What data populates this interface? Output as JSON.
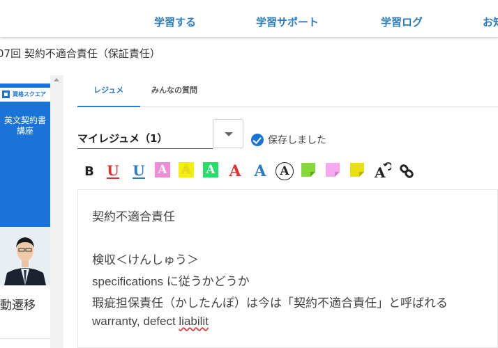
{
  "nav": {
    "items": [
      "学習する",
      "学習サポート",
      "学習ログ",
      "お知"
    ]
  },
  "breadcrumb": "07回 契約不適合責任（保証責任）",
  "left": {
    "logo_text": "資格スクエア",
    "course_title": "英文契約書\n講座",
    "label": "動遷移"
  },
  "tabs": [
    "レジュメ",
    "みんなの質問"
  ],
  "resume": {
    "selected": "マイレジュメ（1）",
    "saved_text": "保存しました"
  },
  "toolbar": {
    "bold": "B",
    "underline_red": "U",
    "underline_blue": "U",
    "highlight_a": "A"
  },
  "colors": {
    "accent": "#2a7bc0",
    "red": "#e03030",
    "blue": "#2a7bc0",
    "pink": "#f08bd8",
    "yellow": "#f5f00a",
    "green": "#22e06a",
    "note_green": "#86d936",
    "note_pink": "#f5a8ee",
    "note_yellow": "#e8e012"
  },
  "editor": {
    "lines": [
      "契約不適合責任",
      "",
      "検収＜けんしゅう＞",
      "specifications に従うかどうか",
      "瑕疵担保責任（かしたんぽ）は今は「契約不適合責任」と呼ばれる",
      "warranty, defect "
    ],
    "misspelled": "liabilit"
  }
}
